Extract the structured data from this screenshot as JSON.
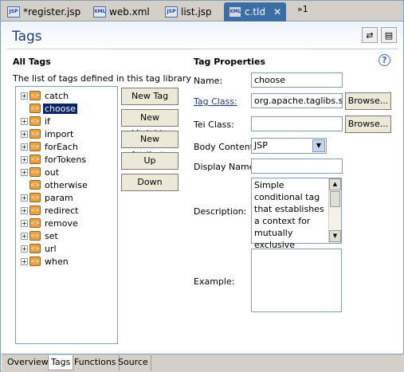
{
  "editor_tabs": [
    {
      "label": "*register.jsp",
      "icon": "JSP",
      "active": false
    },
    {
      "label": "web.xml",
      "icon": "XML",
      "active": false
    },
    {
      "label": "list.jsp",
      "icon": "JSP",
      "active": false
    },
    {
      "label": "c.tld",
      "icon": "XML",
      "active": true
    }
  ],
  "close_glyph": "✕",
  "more_tabs": "»1",
  "page_title": "Tags",
  "all_tags": {
    "heading": "All Tags",
    "description": "The list of tags defined in this tag library",
    "items": [
      {
        "label": "catch",
        "expandable": true,
        "selected": false
      },
      {
        "label": "choose",
        "expandable": false,
        "selected": true
      },
      {
        "label": "if",
        "expandable": true,
        "selected": false
      },
      {
        "label": "import",
        "expandable": true,
        "selected": false
      },
      {
        "label": "forEach",
        "expandable": true,
        "selected": false
      },
      {
        "label": "forTokens",
        "expandable": true,
        "selected": false
      },
      {
        "label": "out",
        "expandable": true,
        "selected": false
      },
      {
        "label": "otherwise",
        "expandable": false,
        "selected": false
      },
      {
        "label": "param",
        "expandable": true,
        "selected": false
      },
      {
        "label": "redirect",
        "expandable": true,
        "selected": false
      },
      {
        "label": "remove",
        "expandable": true,
        "selected": false
      },
      {
        "label": "set",
        "expandable": true,
        "selected": false
      },
      {
        "label": "url",
        "expandable": true,
        "selected": false
      },
      {
        "label": "when",
        "expandable": true,
        "selected": false
      }
    ]
  },
  "buttons": {
    "new_tag": "New Tag",
    "new_variable": "New Variable",
    "new_attribute": "New Attribute",
    "up": "Up",
    "down": "Down"
  },
  "tag_properties": {
    "heading": "Tag Properties",
    "help": "?",
    "name_label": "Name:",
    "name_value": "choose",
    "tag_class_label": "Tag Class:",
    "tag_class_value": "org.apache.taglibs.star",
    "tei_class_label": "Tei Class:",
    "tei_class_value": "",
    "browse_label": "Browse...",
    "body_content_label": "Body Content:",
    "body_content_value": "JSP",
    "display_name_label": "Display Name:",
    "display_name_value": "",
    "description_label": "Description:",
    "description_value": "Simple conditional tag that establishes a context for mutually exclusive",
    "example_label": "Example:",
    "example_value": ""
  },
  "bottom_tabs": [
    {
      "label": "Overview",
      "active": false
    },
    {
      "label": "Tags",
      "active": true
    },
    {
      "label": "Functions",
      "active": false
    },
    {
      "label": "Source",
      "active": false
    }
  ]
}
